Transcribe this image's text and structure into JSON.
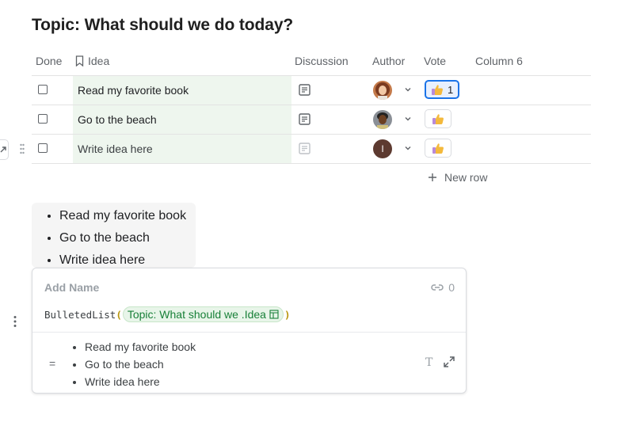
{
  "page": {
    "title": "Topic: What should we do today?"
  },
  "table": {
    "columns": {
      "done": "Done",
      "idea": "Idea",
      "discussion": "Discussion",
      "author": "Author",
      "vote": "Vote",
      "col6": "Column 6"
    },
    "rows": [
      {
        "idea": "Read my favorite book",
        "vote_count": "1",
        "vote_active": true,
        "avatar": "woman-curly-hair"
      },
      {
        "idea": "Go to the beach",
        "vote_count": "",
        "vote_active": false,
        "avatar": "man-dark-skin"
      },
      {
        "idea": "Write idea here",
        "vote_count": "",
        "vote_active": false,
        "avatar": "initial-I",
        "avatar_initial": "I"
      }
    ],
    "new_row_label": "New row"
  },
  "bulleted_list": {
    "items": [
      "Read my favorite book",
      "Go to the beach",
      "Write idea here"
    ]
  },
  "formula_card": {
    "name_placeholder": "Add Name",
    "ref_count": "0",
    "formula_fn": "BulletedList",
    "open_paren": "(",
    "close_paren": ")",
    "chip_label": "Topic: What should we .Idea",
    "equals": "=",
    "result_items": [
      "Read my favorite book",
      "Go to the beach",
      "Write idea here"
    ],
    "text_format_glyph": "T"
  },
  "icons": {
    "bookmark": "bookmark-icon",
    "discussion": "document-icon",
    "chevron": "chevron-down-icon",
    "thumb": "thumbs-up-icon",
    "plus": "plus-icon",
    "link": "link-icon",
    "expand": "expand-icon",
    "more": "more-vertical-icon",
    "grip": "drag-handle-icon"
  },
  "colors": {
    "accent": "#1a73e8",
    "idea_cell_bg": "#eef6ee",
    "chip_text": "#188038",
    "avatar_initial_bg": "#5d3a30"
  }
}
